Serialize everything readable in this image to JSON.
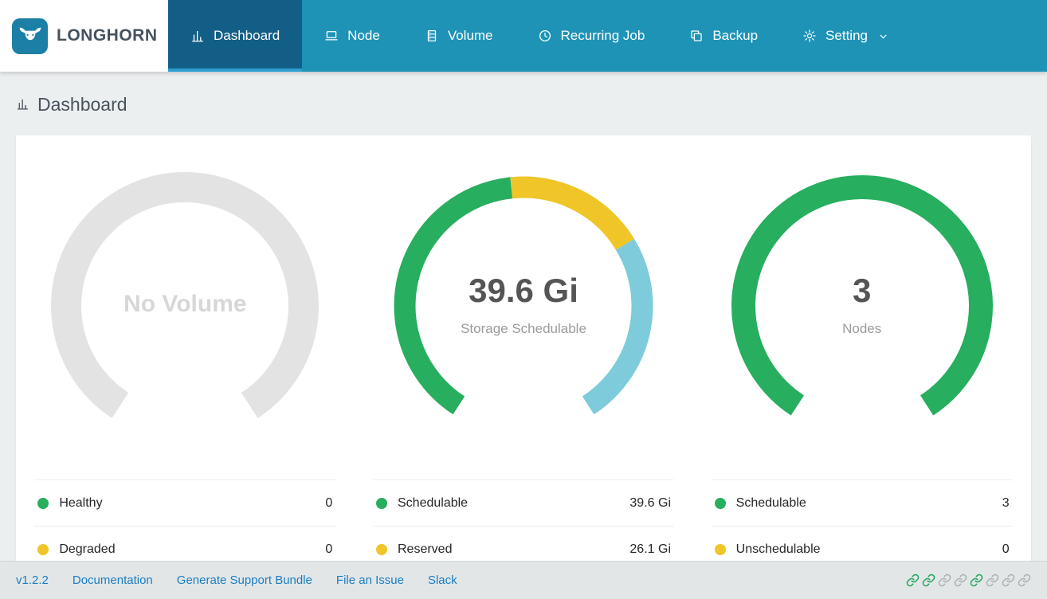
{
  "navbar": {
    "brand": "LONGHORN",
    "items": [
      {
        "label": "Dashboard",
        "icon": "bar-chart",
        "active": true
      },
      {
        "label": "Node",
        "icon": "laptop",
        "active": false
      },
      {
        "label": "Volume",
        "icon": "database",
        "active": false
      },
      {
        "label": "Recurring Job",
        "icon": "clock",
        "active": false
      },
      {
        "label": "Backup",
        "icon": "copy",
        "active": false
      },
      {
        "label": "Setting",
        "icon": "gear",
        "active": false,
        "has_submenu": true
      }
    ]
  },
  "page": {
    "title": "Dashboard"
  },
  "chart_data": [
    {
      "type": "donut-gauge",
      "name": "volume-health",
      "center_value": "No Volume",
      "center_label": "",
      "thickness": 38,
      "segments": [
        {
          "name": "empty",
          "color": "#e3e3e3",
          "fraction": 1
        }
      ],
      "legend": [
        {
          "label": "Healthy",
          "color": "#27ae5e",
          "value": "0"
        },
        {
          "label": "Degraded",
          "color": "#f0c528",
          "value": "0"
        }
      ]
    },
    {
      "type": "donut-gauge",
      "name": "storage-schedulable",
      "center_value": "39.6 Gi",
      "center_label": "Storage Schedulable",
      "thickness": 27,
      "segments": [
        {
          "name": "schedulable",
          "color": "#27ae5e",
          "fraction": 0.48
        },
        {
          "name": "reserved",
          "color": "#f0c528",
          "fraction": 0.22
        },
        {
          "name": "other",
          "color": "#7dcbdb",
          "fraction": 0.3
        }
      ],
      "legend": [
        {
          "label": "Schedulable",
          "color": "#27ae5e",
          "value": "39.6 Gi"
        },
        {
          "label": "Reserved",
          "color": "#f0c528",
          "value": "26.1 Gi"
        }
      ]
    },
    {
      "type": "donut-gauge",
      "name": "nodes",
      "center_value": "3",
      "center_label": "Nodes",
      "thickness": 30,
      "segments": [
        {
          "name": "schedulable",
          "color": "#27ae5e",
          "fraction": 1
        }
      ],
      "legend": [
        {
          "label": "Schedulable",
          "color": "#27ae5e",
          "value": "3"
        },
        {
          "label": "Unschedulable",
          "color": "#f0c528",
          "value": "0"
        }
      ]
    }
  ],
  "footer": {
    "version": "v1.2.2",
    "links": [
      "Documentation",
      "Generate Support Bundle",
      "File an Issue",
      "Slack"
    ],
    "link_icon_colors": [
      "#21a35c",
      "#21a35c",
      "#aab0b3",
      "#aab0b3",
      "#21a35c",
      "#aab0b3",
      "#aab0b3",
      "#aab0b3"
    ]
  },
  "colors": {
    "navbar": "#1e93b6",
    "navbar_active": "#135e86",
    "accent_green": "#27ae5e",
    "accent_yellow": "#f0c528",
    "accent_blue": "#7dcbdb"
  }
}
